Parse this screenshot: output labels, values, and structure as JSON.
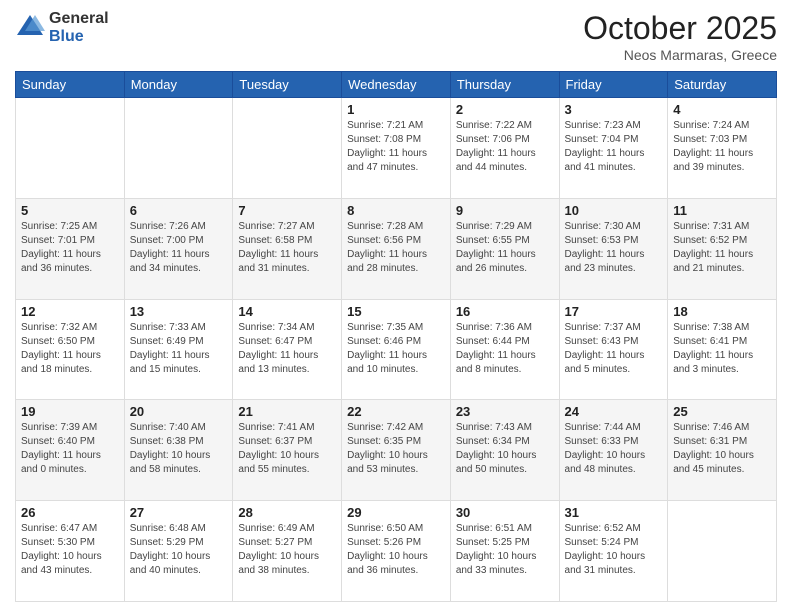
{
  "header": {
    "logo_general": "General",
    "logo_blue": "Blue",
    "month_title": "October 2025",
    "location": "Neos Marmaras, Greece"
  },
  "days_of_week": [
    "Sunday",
    "Monday",
    "Tuesday",
    "Wednesday",
    "Thursday",
    "Friday",
    "Saturday"
  ],
  "weeks": [
    [
      {
        "day": "",
        "info": ""
      },
      {
        "day": "",
        "info": ""
      },
      {
        "day": "",
        "info": ""
      },
      {
        "day": "1",
        "info": "Sunrise: 7:21 AM\nSunset: 7:08 PM\nDaylight: 11 hours\nand 47 minutes."
      },
      {
        "day": "2",
        "info": "Sunrise: 7:22 AM\nSunset: 7:06 PM\nDaylight: 11 hours\nand 44 minutes."
      },
      {
        "day": "3",
        "info": "Sunrise: 7:23 AM\nSunset: 7:04 PM\nDaylight: 11 hours\nand 41 minutes."
      },
      {
        "day": "4",
        "info": "Sunrise: 7:24 AM\nSunset: 7:03 PM\nDaylight: 11 hours\nand 39 minutes."
      }
    ],
    [
      {
        "day": "5",
        "info": "Sunrise: 7:25 AM\nSunset: 7:01 PM\nDaylight: 11 hours\nand 36 minutes."
      },
      {
        "day": "6",
        "info": "Sunrise: 7:26 AM\nSunset: 7:00 PM\nDaylight: 11 hours\nand 34 minutes."
      },
      {
        "day": "7",
        "info": "Sunrise: 7:27 AM\nSunset: 6:58 PM\nDaylight: 11 hours\nand 31 minutes."
      },
      {
        "day": "8",
        "info": "Sunrise: 7:28 AM\nSunset: 6:56 PM\nDaylight: 11 hours\nand 28 minutes."
      },
      {
        "day": "9",
        "info": "Sunrise: 7:29 AM\nSunset: 6:55 PM\nDaylight: 11 hours\nand 26 minutes."
      },
      {
        "day": "10",
        "info": "Sunrise: 7:30 AM\nSunset: 6:53 PM\nDaylight: 11 hours\nand 23 minutes."
      },
      {
        "day": "11",
        "info": "Sunrise: 7:31 AM\nSunset: 6:52 PM\nDaylight: 11 hours\nand 21 minutes."
      }
    ],
    [
      {
        "day": "12",
        "info": "Sunrise: 7:32 AM\nSunset: 6:50 PM\nDaylight: 11 hours\nand 18 minutes."
      },
      {
        "day": "13",
        "info": "Sunrise: 7:33 AM\nSunset: 6:49 PM\nDaylight: 11 hours\nand 15 minutes."
      },
      {
        "day": "14",
        "info": "Sunrise: 7:34 AM\nSunset: 6:47 PM\nDaylight: 11 hours\nand 13 minutes."
      },
      {
        "day": "15",
        "info": "Sunrise: 7:35 AM\nSunset: 6:46 PM\nDaylight: 11 hours\nand 10 minutes."
      },
      {
        "day": "16",
        "info": "Sunrise: 7:36 AM\nSunset: 6:44 PM\nDaylight: 11 hours\nand 8 minutes."
      },
      {
        "day": "17",
        "info": "Sunrise: 7:37 AM\nSunset: 6:43 PM\nDaylight: 11 hours\nand 5 minutes."
      },
      {
        "day": "18",
        "info": "Sunrise: 7:38 AM\nSunset: 6:41 PM\nDaylight: 11 hours\nand 3 minutes."
      }
    ],
    [
      {
        "day": "19",
        "info": "Sunrise: 7:39 AM\nSunset: 6:40 PM\nDaylight: 11 hours\nand 0 minutes."
      },
      {
        "day": "20",
        "info": "Sunrise: 7:40 AM\nSunset: 6:38 PM\nDaylight: 10 hours\nand 58 minutes."
      },
      {
        "day": "21",
        "info": "Sunrise: 7:41 AM\nSunset: 6:37 PM\nDaylight: 10 hours\nand 55 minutes."
      },
      {
        "day": "22",
        "info": "Sunrise: 7:42 AM\nSunset: 6:35 PM\nDaylight: 10 hours\nand 53 minutes."
      },
      {
        "day": "23",
        "info": "Sunrise: 7:43 AM\nSunset: 6:34 PM\nDaylight: 10 hours\nand 50 minutes."
      },
      {
        "day": "24",
        "info": "Sunrise: 7:44 AM\nSunset: 6:33 PM\nDaylight: 10 hours\nand 48 minutes."
      },
      {
        "day": "25",
        "info": "Sunrise: 7:46 AM\nSunset: 6:31 PM\nDaylight: 10 hours\nand 45 minutes."
      }
    ],
    [
      {
        "day": "26",
        "info": "Sunrise: 6:47 AM\nSunset: 5:30 PM\nDaylight: 10 hours\nand 43 minutes."
      },
      {
        "day": "27",
        "info": "Sunrise: 6:48 AM\nSunset: 5:29 PM\nDaylight: 10 hours\nand 40 minutes."
      },
      {
        "day": "28",
        "info": "Sunrise: 6:49 AM\nSunset: 5:27 PM\nDaylight: 10 hours\nand 38 minutes."
      },
      {
        "day": "29",
        "info": "Sunrise: 6:50 AM\nSunset: 5:26 PM\nDaylight: 10 hours\nand 36 minutes."
      },
      {
        "day": "30",
        "info": "Sunrise: 6:51 AM\nSunset: 5:25 PM\nDaylight: 10 hours\nand 33 minutes."
      },
      {
        "day": "31",
        "info": "Sunrise: 6:52 AM\nSunset: 5:24 PM\nDaylight: 10 hours\nand 31 minutes."
      },
      {
        "day": "",
        "info": ""
      }
    ]
  ]
}
